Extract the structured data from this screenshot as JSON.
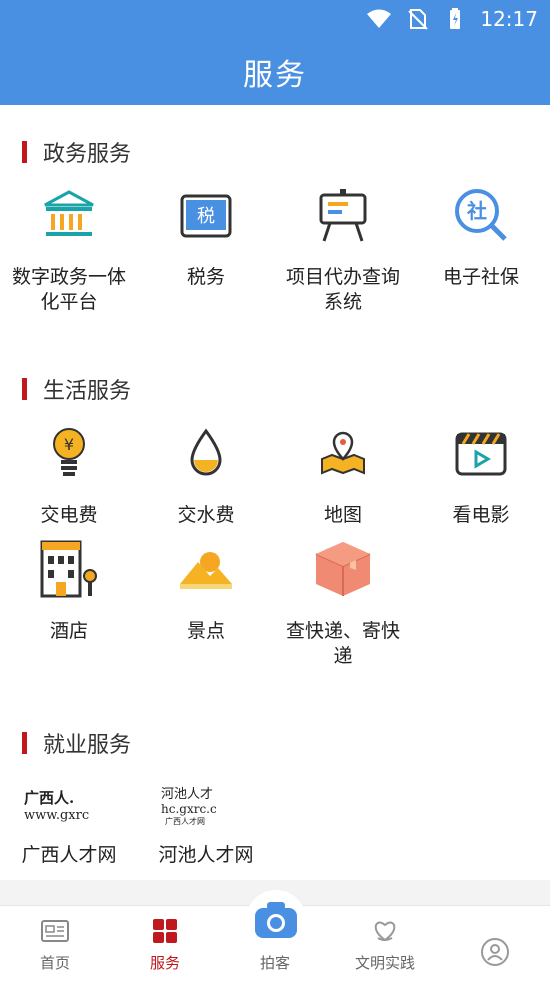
{
  "status_bar": {
    "time": "12:17"
  },
  "header": {
    "title": "服务"
  },
  "sections": {
    "gov": {
      "title": "政务服务",
      "items": [
        {
          "label": "数字政务一体化平台",
          "icon": "government-building-icon"
        },
        {
          "label": "税务",
          "icon": "tax-icon",
          "icon_text": "税"
        },
        {
          "label": "项目代办查询系统",
          "icon": "presentation-board-icon"
        },
        {
          "label": "电子社保",
          "icon": "social-security-search-icon",
          "icon_text": "社"
        }
      ]
    },
    "life": {
      "title": "生活服务",
      "items": [
        {
          "label": "交电费",
          "icon": "lightbulb-icon",
          "icon_text": "¥"
        },
        {
          "label": "交水费",
          "icon": "water-drop-icon"
        },
        {
          "label": "地图",
          "icon": "map-pin-icon"
        },
        {
          "label": "看电影",
          "icon": "movie-clapper-icon"
        },
        {
          "label": "酒店",
          "icon": "hotel-icon"
        },
        {
          "label": "景点",
          "icon": "mountain-sun-icon"
        },
        {
          "label": "查快递、寄快递",
          "icon": "parcel-box-icon"
        }
      ]
    },
    "jobs": {
      "title": "就业服务",
      "items": [
        {
          "label": "广西人才网",
          "logo_line1": "广西人.",
          "logo_line2": "www.gxrc"
        },
        {
          "label": "河池人才网",
          "logo_line1": "河池人才",
          "logo_line2": "hc.gxrc.c",
          "logo_line3": "广西人才网"
        }
      ]
    }
  },
  "tabbar": {
    "items": [
      {
        "label": "首页",
        "icon": "newspaper-icon"
      },
      {
        "label": "服务",
        "icon": "grid-icon",
        "active": true
      },
      {
        "label": "拍客",
        "icon": "camera-icon"
      },
      {
        "label": "文明实践",
        "icon": "heart-hand-icon"
      },
      {
        "label": "",
        "icon": "user-icon"
      }
    ]
  },
  "colors": {
    "header": "#4a90e2",
    "accent": "#c0181f",
    "orange": "#f5a623",
    "teal": "#1aa3a8"
  }
}
